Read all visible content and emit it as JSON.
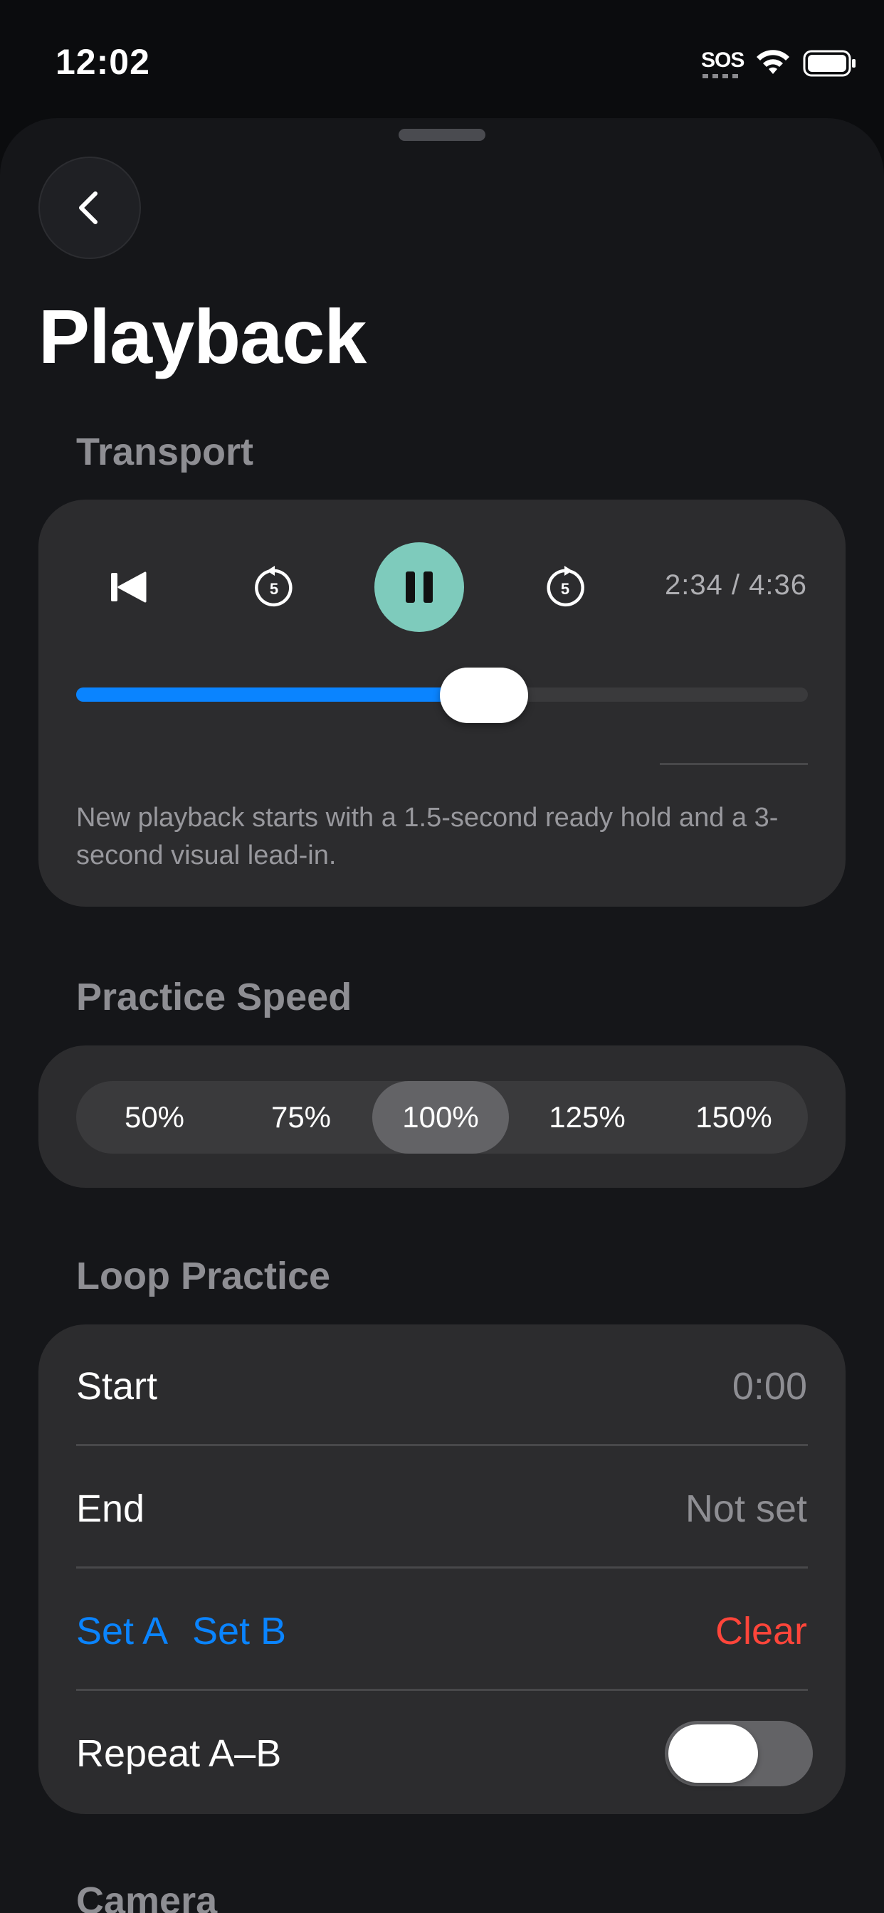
{
  "status_bar": {
    "time": "12:02",
    "sos": "SOS"
  },
  "header": {
    "back_icon": "chevron-left-icon",
    "title": "Playback"
  },
  "transport": {
    "section_label": "Transport",
    "controls": {
      "skip_to_start_icon": "skip-to-start-icon",
      "rewind_icon": "rewind-5-icon",
      "rewind_seconds": "5",
      "pause_icon": "pause-icon",
      "forward_icon": "forward-5-icon",
      "forward_seconds": "5"
    },
    "time_readout": "2:34 / 4:36",
    "progress_fraction": 0.557,
    "note": "New playback starts with a 1.5-second ready hold and a 3-second visual lead-in."
  },
  "speed": {
    "section_label": "Practice Speed",
    "options": [
      "50%",
      "75%",
      "100%",
      "125%",
      "150%"
    ],
    "selected": "100%"
  },
  "loop": {
    "section_label": "Loop Practice",
    "start_label": "Start",
    "start_value": "0:00",
    "end_label": "End",
    "end_value": "Not set",
    "set_a_label": "Set A",
    "set_b_label": "Set B",
    "clear_label": "Clear",
    "repeat_label": "Repeat A–B",
    "repeat_enabled": false
  },
  "camera": {
    "section_label": "Camera"
  },
  "colors": {
    "accent_blue": "#0a84ff",
    "accent_teal": "#7ecbbc",
    "destructive_red": "#ff453a",
    "card_background": "#2c2c2e"
  }
}
